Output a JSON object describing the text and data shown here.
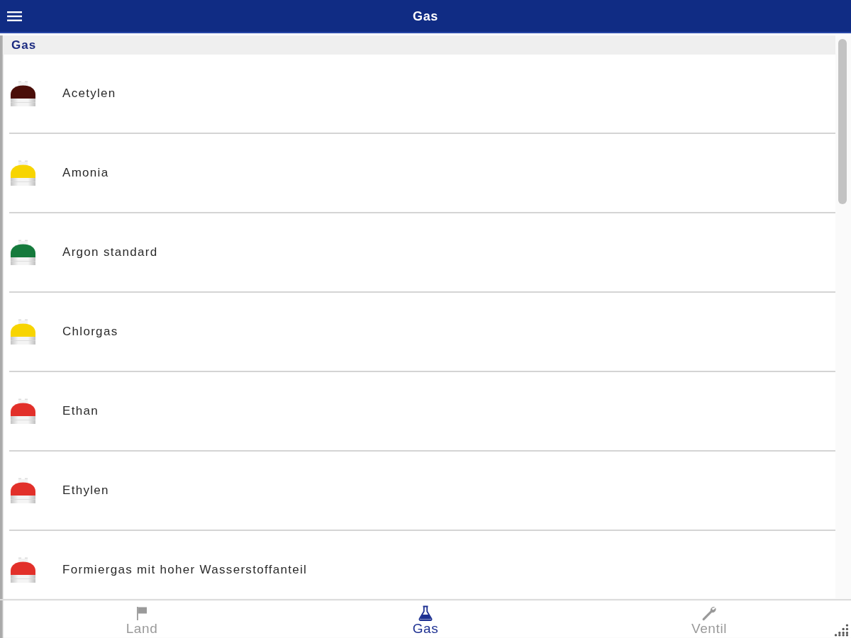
{
  "header": {
    "title": "Gas"
  },
  "section": {
    "title": "Gas"
  },
  "gases": [
    {
      "name": "Acetylen",
      "color": "#4a0e08"
    },
    {
      "name": "Amonia",
      "color": "#f7d400"
    },
    {
      "name": "Argon standard",
      "color": "#157a3c"
    },
    {
      "name": "Chlorgas",
      "color": "#f7d400"
    },
    {
      "name": "Ethan",
      "color": "#e2302a"
    },
    {
      "name": "Ethylen",
      "color": "#e2302a"
    },
    {
      "name": "Formiergas mit hoher Wasserstoffanteil",
      "color": "#e2302a"
    }
  ],
  "tabs": [
    {
      "label": "Land",
      "kind": "flag",
      "selected": false
    },
    {
      "label": "Gas",
      "kind": "flask",
      "selected": true
    },
    {
      "label": "Ventil",
      "kind": "wrench",
      "selected": false
    }
  ]
}
